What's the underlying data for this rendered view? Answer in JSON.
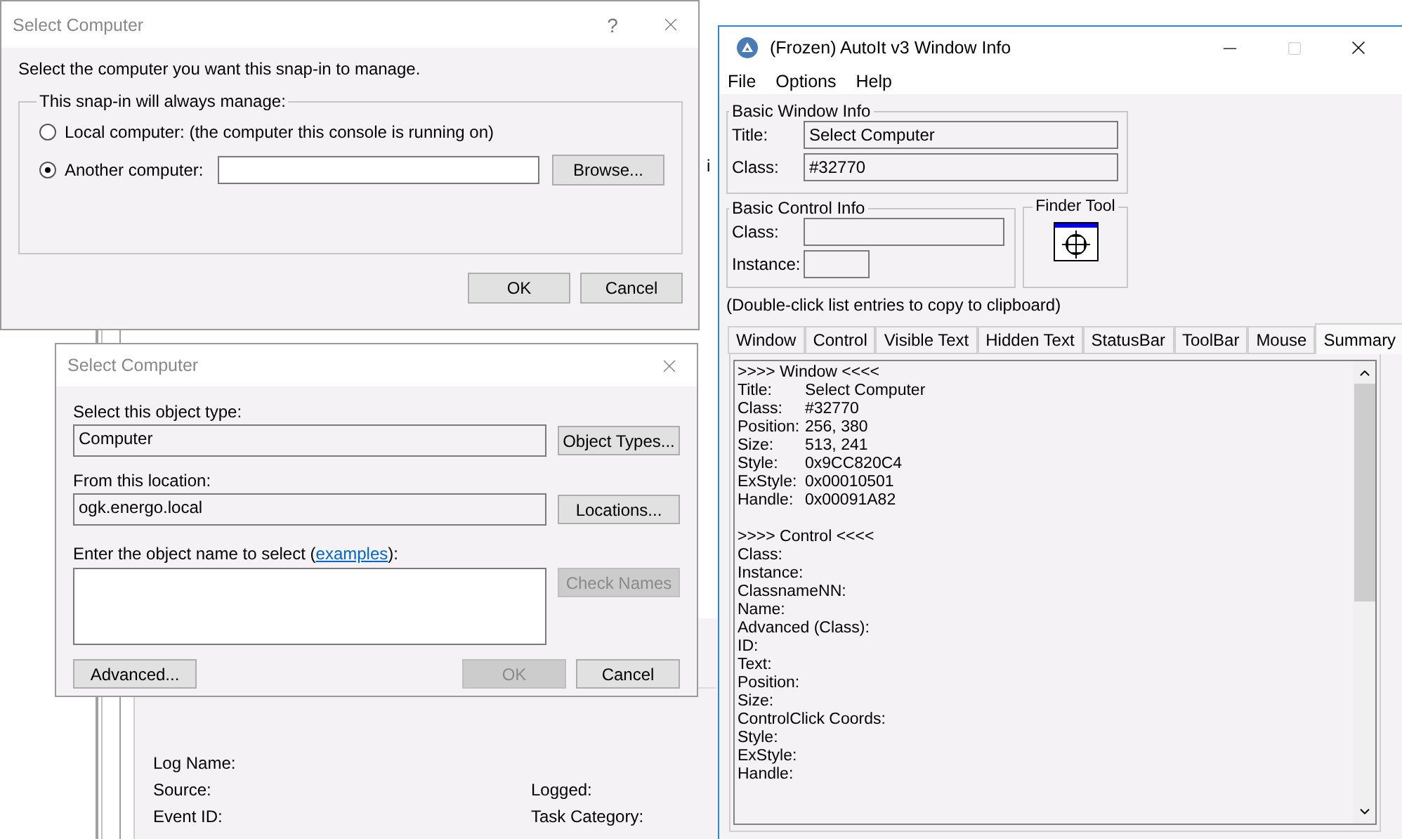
{
  "background": {
    "fragment": "i",
    "details": [
      {
        "cells": [
          "Log Name:"
        ]
      },
      {
        "cells": [
          "Source:",
          "Logged:"
        ]
      },
      {
        "cells": [
          "Event ID:",
          "Task Category:"
        ]
      }
    ]
  },
  "select_computer": {
    "title": "Select Computer",
    "help_button": "?",
    "instruction": "Select the computer you want this snap-in to manage.",
    "group_label": "This snap-in will always manage:",
    "options": [
      {
        "label": "Local computer:  (the computer this console is running on)",
        "selected": false
      },
      {
        "label": "Another computer:",
        "selected": true
      }
    ],
    "browse_button": "Browse...",
    "buttons": [
      {
        "label": "OK",
        "disabled": false
      },
      {
        "label": "Cancel",
        "disabled": false
      }
    ]
  },
  "object_picker": {
    "title": "Select Computer",
    "type_label": "Select this object type:",
    "type_value": "Computer",
    "type_button": "Object Types...",
    "location_label": "From this location:",
    "location_value": "ogk.energo.local",
    "location_button": "Locations...",
    "name_label": {
      "before": "Enter the object name to select (",
      "link": "examples",
      "after": "):"
    },
    "check_button": {
      "label": "Check Names",
      "disabled": true
    },
    "advanced_button": "Advanced...",
    "buttons": [
      {
        "label": "OK",
        "disabled": true
      },
      {
        "label": "Cancel",
        "disabled": false
      }
    ]
  },
  "window_info": {
    "title": "(Frozen) AutoIt v3 Window Info",
    "menu": [
      "File",
      "Options",
      "Help"
    ],
    "basic_window": {
      "legend": "Basic Window Info",
      "title_label": "Title:",
      "title_value": "Select Computer",
      "class_label": "Class:",
      "class_value": "#32770"
    },
    "basic_control": {
      "legend": "Basic Control Info",
      "class_label": "Class:",
      "instance_label": "Instance:"
    },
    "finder": {
      "legend": "Finder Tool"
    },
    "hint": "(Double-click list entries to copy to clipboard)",
    "tabs": [
      {
        "label": "Window",
        "selected": false
      },
      {
        "label": "Control",
        "selected": false
      },
      {
        "label": "Visible Text",
        "selected": false
      },
      {
        "label": "Hidden Text",
        "selected": false
      },
      {
        "label": "StatusBar",
        "selected": false
      },
      {
        "label": "ToolBar",
        "selected": false
      },
      {
        "label": "Mouse",
        "selected": false
      },
      {
        "label": "Summary",
        "selected": true
      }
    ],
    "summary": [
      {
        "kind": "header",
        "text": ">>>> Window <<<<"
      },
      {
        "kind": "field",
        "label": "Title:",
        "value": "Select Computer"
      },
      {
        "kind": "field",
        "label": "Class:",
        "value": "#32770"
      },
      {
        "kind": "field",
        "label": "Position:",
        "value": "256, 380"
      },
      {
        "kind": "field",
        "label": "Size:",
        "value": "513, 241"
      },
      {
        "kind": "field",
        "label": "Style:",
        "value": "0x9CC820C4"
      },
      {
        "kind": "field",
        "label": "ExStyle:",
        "value": "0x00010501"
      },
      {
        "kind": "field",
        "label": "Handle:",
        "value": "0x00091A82"
      },
      {
        "kind": "blank"
      },
      {
        "kind": "header",
        "text": ">>>> Control <<<<"
      },
      {
        "kind": "header",
        "text": "Class:"
      },
      {
        "kind": "header",
        "text": "Instance:"
      },
      {
        "kind": "header",
        "text": "ClassnameNN:"
      },
      {
        "kind": "header",
        "text": "Name:"
      },
      {
        "kind": "header",
        "text": "Advanced (Class):"
      },
      {
        "kind": "header",
        "text": "ID:"
      },
      {
        "kind": "header",
        "text": "Text:"
      },
      {
        "kind": "header",
        "text": "Position:"
      },
      {
        "kind": "header",
        "text": "Size:"
      },
      {
        "kind": "header",
        "text": "ControlClick Coords:"
      },
      {
        "kind": "header",
        "text": "Style:"
      },
      {
        "kind": "header",
        "text": "ExStyle:"
      },
      {
        "kind": "header",
        "text": "Handle:"
      }
    ]
  }
}
